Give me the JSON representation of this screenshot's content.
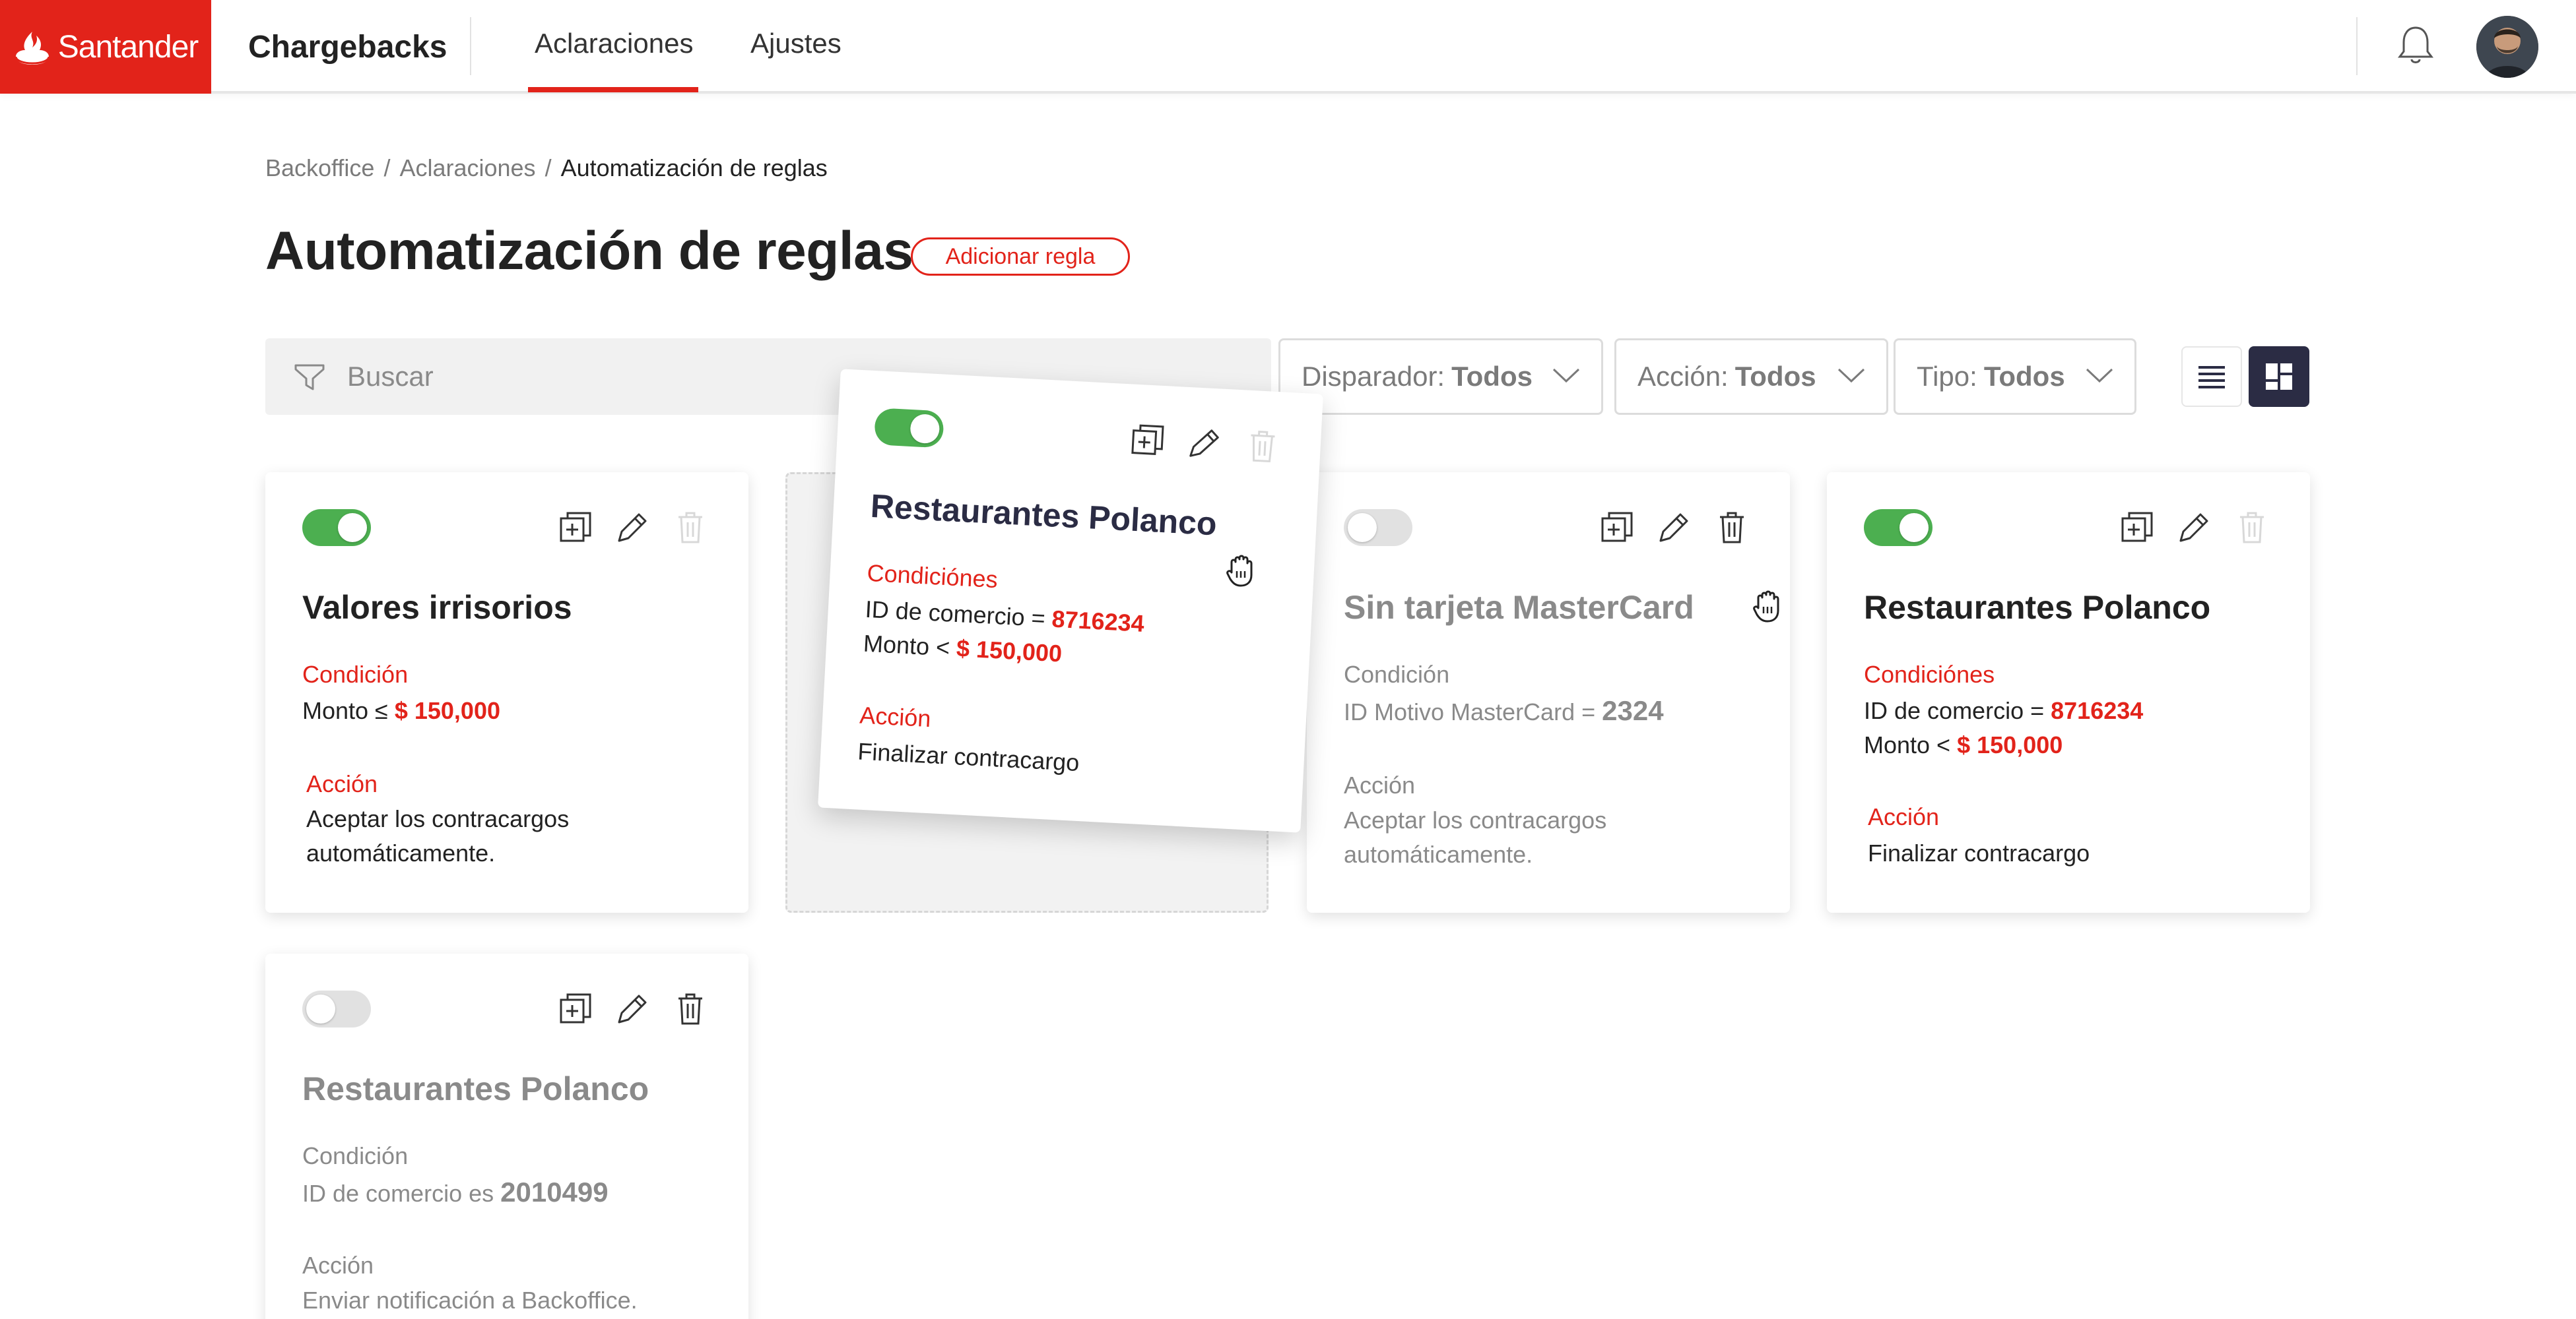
{
  "brand": {
    "name": "Santander",
    "color": "#e2231a"
  },
  "app": {
    "name": "Chargebacks"
  },
  "nav": {
    "tabs": [
      {
        "label": "Aclaraciones",
        "active": true
      },
      {
        "label": "Ajustes",
        "active": false
      }
    ]
  },
  "header_icons": {
    "bell": "bell-icon",
    "avatar": "user-avatar"
  },
  "breadcrumb": {
    "items": [
      "Backoffice",
      "Aclaraciones",
      "Automatización de reglas"
    ],
    "separator": "/"
  },
  "page": {
    "title": "Automatización de reglas",
    "add_button": "Adicionar regla"
  },
  "filters": {
    "search_placeholder": "Buscar",
    "trigger": {
      "label": "Disparador:",
      "value": "Todos"
    },
    "action": {
      "label": "Acción:",
      "value": "Todos"
    },
    "type": {
      "label": "Tipo:",
      "value": "Todos"
    }
  },
  "view_mode": {
    "options": [
      "list",
      "grid"
    ],
    "selected": "grid"
  },
  "colors": {
    "accent": "#e2231a",
    "toggle_on": "#4caf50",
    "toggle_off": "#e1e1e1",
    "dark_button": "#2b2c44"
  },
  "cards": [
    {
      "enabled": true,
      "title": "Valores irrisorios",
      "condition_label": "Condición",
      "condition_text": "Monto ≤",
      "condition_value": "$ 150,000",
      "action_label": "Acción",
      "action_line1": "Aceptar los contracargos",
      "action_line2": "automáticamente."
    },
    {
      "enabled": true,
      "dragging": true,
      "title": "Restaurantes Polanco",
      "condition_label": "Condiciónes",
      "cond1_text": "ID de comercio =",
      "cond1_value": "8716234",
      "cond2_text": "Monto <",
      "cond2_value": "$ 150,000",
      "action_label": "Acción",
      "action_text": "Finalizar contracargo"
    },
    {
      "enabled": false,
      "title": "Sin tarjeta MasterCard",
      "condition_label": "Condición",
      "condition_text": "ID Motivo MasterCard =",
      "condition_value": "2324",
      "action_label": "Acción",
      "action_line1": "Aceptar los contracargos",
      "action_line2": "automáticamente."
    },
    {
      "enabled": true,
      "title": "Restaurantes Polanco",
      "condition_label": "Condiciónes",
      "cond1_text": "ID de comercio =",
      "cond1_value": "8716234",
      "cond2_text": "Monto <",
      "cond2_value": "$ 150,000",
      "action_label": "Acción",
      "action_text": "Finalizar contracargo"
    },
    {
      "enabled": false,
      "title": "Restaurantes Polanco",
      "condition_label": "Condición",
      "condition_text": "ID de comercio es",
      "condition_value": "2010499",
      "action_label": "Acción",
      "action_text": "Enviar notificación a Backoffice."
    }
  ]
}
